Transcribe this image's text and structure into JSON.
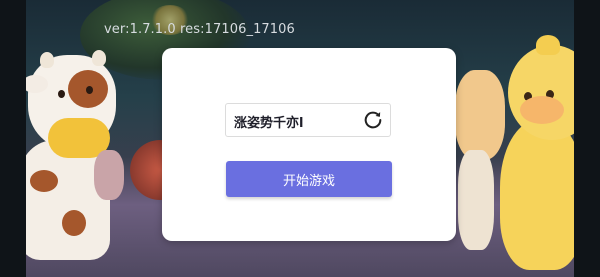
{
  "version_label": "ver:1.7.1.0  res:17106_17106",
  "dialog": {
    "name_value": "涨姿势千亦l",
    "refresh_icon": "refresh-icon",
    "start_button_label": "开始游戏",
    "start_button_color": "#6a6fe0"
  }
}
